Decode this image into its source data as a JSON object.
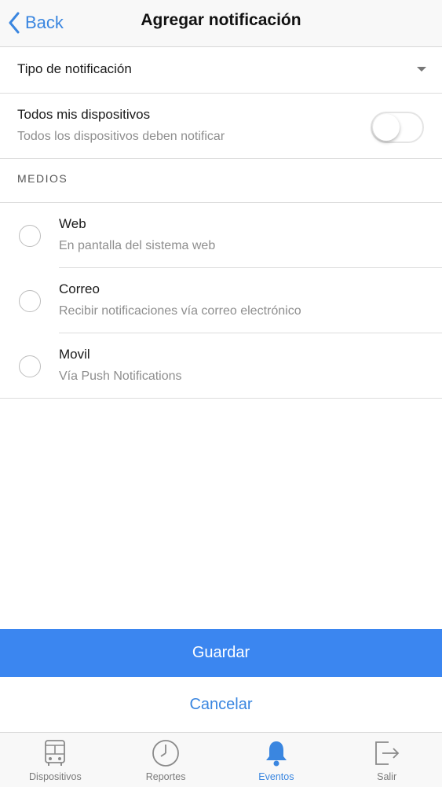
{
  "nav": {
    "back_label": "Back",
    "title": "Agregar notificación"
  },
  "notification_type": {
    "label": "Tipo de notificación"
  },
  "all_devices": {
    "title": "Todos mis dispositivos",
    "subtitle": "Todos los dispositivos deben notificar",
    "enabled": false
  },
  "media": {
    "header": "MEDIOS",
    "items": [
      {
        "title": "Web",
        "subtitle": "En pantalla del sistema web",
        "selected": false
      },
      {
        "title": "Correo",
        "subtitle": "Recibir notificaciones vía correo electrónico",
        "selected": false
      },
      {
        "title": "Movil",
        "subtitle": "Vía Push Notifications",
        "selected": false
      }
    ]
  },
  "actions": {
    "save_label": "Guardar",
    "cancel_label": "Cancelar"
  },
  "tabbar": {
    "active": "Eventos",
    "accent_color": "#3a86e0",
    "tabs": [
      {
        "label": "Dispositivos",
        "icon": "bus-icon"
      },
      {
        "label": "Reportes",
        "icon": "clock-icon"
      },
      {
        "label": "Eventos",
        "icon": "bell-icon"
      },
      {
        "label": "Salir",
        "icon": "logout-icon"
      }
    ]
  }
}
